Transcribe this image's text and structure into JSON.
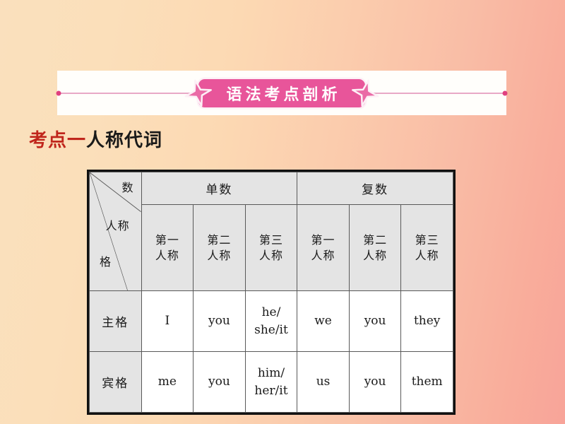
{
  "banner": {
    "title": "语法考点剖析",
    "accent_color": "#e8559a",
    "rule_color": "#e8a8c6",
    "dot_color": "#e0407f",
    "left_star_icon": "star-icon",
    "right_star_icon": "star-icon"
  },
  "section": {
    "number_label": "考点一",
    "name_label": "人称代词",
    "number_color": "#c0261c",
    "name_color": "#1a1a1a"
  },
  "background": {
    "gradient_from": "#fae0bd",
    "gradient_to": "#f8a499"
  },
  "table": {
    "corner": {
      "top_label": "数",
      "middle_label": "人称",
      "bottom_label": "格"
    },
    "group_headers": [
      {
        "label": "单数",
        "span": 3
      },
      {
        "label": "复数",
        "span": 3
      }
    ],
    "person_headers": [
      "第一\n人称",
      "第二\n人称",
      "第三\n人称",
      "第一\n人称",
      "第二\n人称",
      "第三\n人称"
    ],
    "person_headers_lines": [
      [
        "第一",
        "人称"
      ],
      [
        "第二",
        "人称"
      ],
      [
        "第三",
        "人称"
      ],
      [
        "第一",
        "人称"
      ],
      [
        "第二",
        "人称"
      ],
      [
        "第三",
        "人称"
      ]
    ],
    "rows": [
      {
        "case_label": "主格",
        "cells": [
          {
            "lines": [
              "I"
            ]
          },
          {
            "lines": [
              "you"
            ]
          },
          {
            "lines": [
              "he/",
              "she/it"
            ]
          },
          {
            "lines": [
              "we"
            ]
          },
          {
            "lines": [
              "you"
            ]
          },
          {
            "lines": [
              "they"
            ]
          }
        ]
      },
      {
        "case_label": "宾格",
        "cells": [
          {
            "lines": [
              "me"
            ]
          },
          {
            "lines": [
              "you"
            ]
          },
          {
            "lines": [
              "him/",
              "her/it"
            ]
          },
          {
            "lines": [
              "us"
            ]
          },
          {
            "lines": [
              "you"
            ]
          },
          {
            "lines": [
              "them"
            ]
          }
        ]
      }
    ],
    "header_bg": "#e4e4e4",
    "cell_bg": "#ffffff",
    "border_color": "#111111",
    "grid_color": "#595959"
  }
}
